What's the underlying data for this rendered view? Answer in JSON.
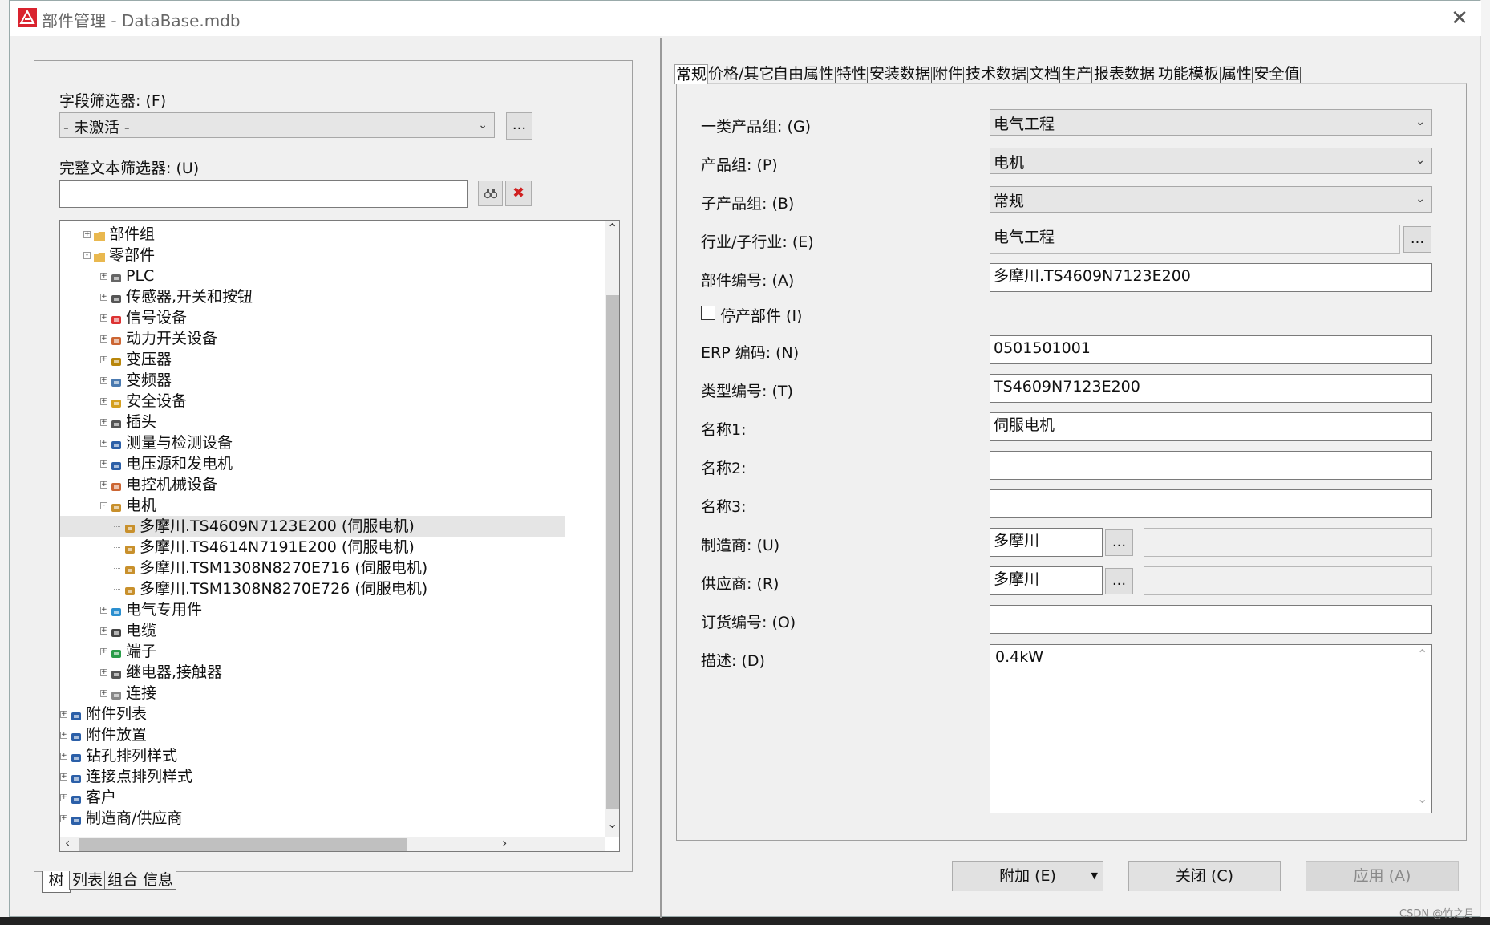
{
  "window": {
    "title": "部件管理 - DataBase.mdb"
  },
  "left": {
    "field_filter_label": "字段筛选器: (F)",
    "field_filter_value": "- 未激活 -",
    "field_filter_btn": "...",
    "text_filter_label": "完整文本筛选器: (U)",
    "text_filter_value": "",
    "tree": [
      {
        "label": "部件组",
        "level": 2,
        "expander": "+",
        "icon": "folder-icon",
        "color": "#e9b84f"
      },
      {
        "label": "零部件",
        "level": 2,
        "expander": "-",
        "icon": "folder-open-icon",
        "color": "#e9b84f"
      },
      {
        "label": "PLC",
        "level": 3,
        "expander": "+",
        "icon": "plc-icon",
        "color": "#666"
      },
      {
        "label": "传感器,开关和按钮",
        "level": 3,
        "expander": "+",
        "icon": "sensor-icon",
        "color": "#555"
      },
      {
        "label": "信号设备",
        "level": 3,
        "expander": "+",
        "icon": "signal-icon",
        "color": "#d33"
      },
      {
        "label": "动力开关设备",
        "level": 3,
        "expander": "+",
        "icon": "power-switch-icon",
        "color": "#c63"
      },
      {
        "label": "变压器",
        "level": 3,
        "expander": "+",
        "icon": "transformer-icon",
        "color": "#b8860b"
      },
      {
        "label": "变频器",
        "level": 3,
        "expander": "+",
        "icon": "inverter-icon",
        "color": "#4a7ab0"
      },
      {
        "label": "安全设备",
        "level": 3,
        "expander": "+",
        "icon": "safety-icon",
        "color": "#d4a020"
      },
      {
        "label": "插头",
        "level": 3,
        "expander": "+",
        "icon": "plug-icon",
        "color": "#555"
      },
      {
        "label": "测量与检测设备",
        "level": 3,
        "expander": "+",
        "icon": "measure-icon",
        "color": "#2b5fa8"
      },
      {
        "label": "电压源和发电机",
        "level": 3,
        "expander": "+",
        "icon": "generator-icon",
        "color": "#2b5fa8"
      },
      {
        "label": "电控机械设备",
        "level": 3,
        "expander": "+",
        "icon": "mechanical-icon",
        "color": "#c63"
      },
      {
        "label": "电机",
        "level": 3,
        "expander": "-",
        "icon": "motor-icon",
        "color": "#c8902c"
      },
      {
        "label": "多摩川.TS4609N7123E200 (伺服电机)",
        "level": 4,
        "expander": "",
        "icon": "motor-icon",
        "color": "#c8902c",
        "selected": true
      },
      {
        "label": "多摩川.TS4614N7191E200 (伺服电机)",
        "level": 4,
        "expander": "",
        "icon": "motor-icon",
        "color": "#c8902c"
      },
      {
        "label": "多摩川.TSM1308N8270E716 (伺服电机)",
        "level": 4,
        "expander": "",
        "icon": "motor-icon",
        "color": "#c8902c"
      },
      {
        "label": "多摩川.TSM1308N8270E726 (伺服电机)",
        "level": 4,
        "expander": "",
        "icon": "motor-icon",
        "color": "#c8902c"
      },
      {
        "label": "电气专用件",
        "level": 3,
        "expander": "+",
        "icon": "special-parts-icon",
        "color": "#2b8fcf"
      },
      {
        "label": "电缆",
        "level": 3,
        "expander": "+",
        "icon": "cable-icon",
        "color": "#444"
      },
      {
        "label": "端子",
        "level": 3,
        "expander": "+",
        "icon": "terminal-icon",
        "color": "#2a9d4a"
      },
      {
        "label": "继电器,接触器",
        "level": 3,
        "expander": "+",
        "icon": "relay-icon",
        "color": "#555"
      },
      {
        "label": "连接",
        "level": 3,
        "expander": "+",
        "icon": "connection-icon",
        "color": "#888"
      },
      {
        "label": "附件列表",
        "level": 1,
        "expander": "+",
        "icon": "accessory-list-icon",
        "color": "#2b5fa8"
      },
      {
        "label": "附件放置",
        "level": 1,
        "expander": "+",
        "icon": "accessory-placement-icon",
        "color": "#2b5fa8"
      },
      {
        "label": "钻孔排列样式",
        "level": 1,
        "expander": "+",
        "icon": "drill-pattern-icon",
        "color": "#2b5fa8"
      },
      {
        "label": "连接点排列样式",
        "level": 1,
        "expander": "+",
        "icon": "connection-pattern-icon",
        "color": "#2b5fa8"
      },
      {
        "label": "客户",
        "level": 1,
        "expander": "+",
        "icon": "customer-icon",
        "color": "#2b5fa8"
      },
      {
        "label": "制造商/供应商",
        "level": 1,
        "expander": "+",
        "icon": "manufacturer-icon",
        "color": "#2b5fa8"
      }
    ],
    "bottom_tabs": [
      "树",
      "列表",
      "组合",
      "信息"
    ]
  },
  "right": {
    "tabs": [
      "常规",
      "价格/其它",
      "自由属性",
      "特性",
      "安装数据",
      "附件",
      "技术数据",
      "文档",
      "生产",
      "报表数据",
      "功能模板",
      "属性",
      "安全值"
    ],
    "fields": {
      "product_group1_label": "一类产品组: (G)",
      "product_group1_value": "电气工程",
      "product_group_label": "产品组: (P)",
      "product_group_value": "电机",
      "sub_product_group_label": "子产品组: (B)",
      "sub_product_group_value": "常规",
      "industry_label": "行业/子行业: (E)",
      "industry_value": "电气工程",
      "part_number_label": "部件编号: (A)",
      "part_number_value": "多摩川.TS4609N7123E200",
      "discontinued_label": "停产部件 (I)",
      "erp_label": "ERP 编码: (N)",
      "erp_value": "0501501001",
      "type_number_label": "类型编号: (T)",
      "type_number_value": "TS4609N7123E200",
      "name1_label": "名称1:",
      "name1_value": "伺服电机",
      "name2_label": "名称2:",
      "name2_value": "",
      "name3_label": "名称3:",
      "name3_value": "",
      "manufacturer_label": "制造商: (U)",
      "manufacturer_value": "多摩川",
      "supplier_label": "供应商: (R)",
      "supplier_value": "多摩川",
      "order_number_label": "订货编号: (O)",
      "order_number_value": "",
      "description_label": "描述: (D)",
      "description_value": "0.4kW",
      "ellipsis": "..."
    },
    "buttons": {
      "add": "附加 (E)",
      "close": "关闭 (C)",
      "apply": "应用 (A)"
    }
  },
  "watermark": "CSDN @竹之月"
}
